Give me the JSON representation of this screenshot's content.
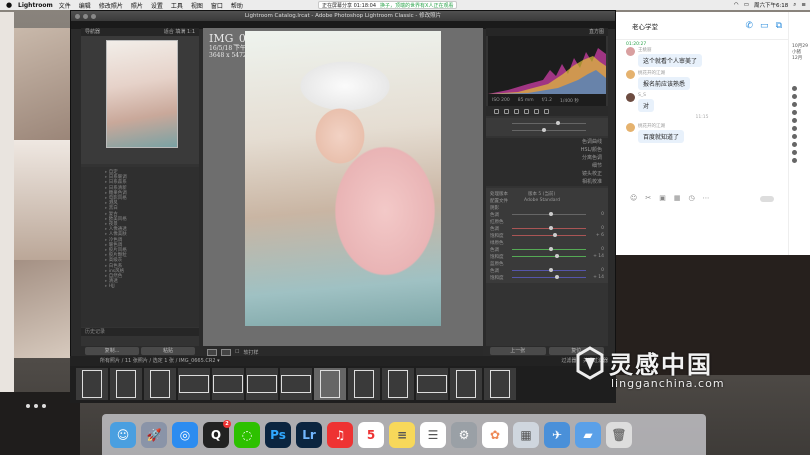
{
  "menubar": {
    "app": "Lightroom",
    "items": [
      "文件",
      "编辑",
      "修改照片",
      "照片",
      "设置",
      "工具",
      "视图",
      "窗口",
      "帮助"
    ],
    "share_status": "正在屏幕分享 01:18:04",
    "share_hint": "换子，顶端的世界有X人正在观看",
    "clock": "周六下午6:18"
  },
  "lightroom": {
    "window_title": "Lightroom Catalog.lrcat - Adobe Photoshop Lightroom Classic - 修改照片",
    "navigator_label": "导航器",
    "navigator_zoom": [
      "适合",
      "填满",
      "1:1"
    ],
    "presets": [
      "自定",
      "日系暖调",
      "日系森系",
      "日系清新",
      "糖果色调",
      "电影风格",
      "港风",
      "黑白",
      "复古",
      "欧美风格",
      "夜景",
      "人像通透",
      "人像美肤",
      "冷色调",
      "暖色调",
      "胶片风格",
      "胶片颗粒",
      "高级灰",
      "白色系",
      "ins风格",
      "自然色",
      "清透",
      "HJJ"
    ],
    "history_label": "历史记录",
    "copy_button": "复制...",
    "paste_button": "粘贴",
    "photo": {
      "filename": "IMG_0665.CR2",
      "line1": "16/5/18 下午2:27:41",
      "line2": "3648 x 5472"
    },
    "toolbar_label": "软打样",
    "histogram_label": "直方图",
    "histogram_info": [
      "ISO 200",
      "85 mm",
      "f/1.2",
      "1/400 秒"
    ],
    "sections": [
      "基本",
      "色调曲线",
      "HSL/颜色",
      "分离色调",
      "细节",
      "镜头校正",
      "相机校准"
    ],
    "calib": {
      "process_label": "处理版本",
      "process_value": "版本 5 (当前)",
      "profile_label": "配置文件",
      "profile_value": "Adobe Standard",
      "shadow_label": "阴影",
      "hue_label": "色调",
      "red_primary": "红原色",
      "green_primary": "绿原色",
      "blue_primary": "蓝原色",
      "sat_label": "饱和度",
      "values": [
        "0",
        "0",
        "0",
        "+ 6",
        "0",
        "+ 14",
        "0",
        "+ 14",
        "+ 14"
      ]
    },
    "prev_button": "上一张",
    "reset_button": "复位",
    "filmstrip_path": "所有照片 / 11 张照片 / 选定 1 张 / IMG_0665.CR2 ▾",
    "filter_label": "过滤器：",
    "filter_value": "关闭过滤器"
  },
  "chat": {
    "title": "老心学堂",
    "messages": [
      {
        "time": "01:20:27",
        "nick": "王桃丽",
        "text": "这个就看个人审美了"
      },
      {
        "time": "",
        "nick": "桃花开的江湖",
        "text": "报名前应该熟悉"
      },
      {
        "time": "",
        "nick": "S_S",
        "text": "对"
      },
      {
        "time": "",
        "nick": "桃花开的江湖",
        "text": "百度就知道了"
      }
    ],
    "system_note": "11:15",
    "side_labels": [
      "10月29",
      "小猪",
      "12月"
    ]
  },
  "watermark": {
    "cn": "灵感中国",
    "en": "lingganchina.com"
  },
  "dock": [
    "Finder",
    "Launchpad",
    "Safari",
    "QQ",
    "WeChat",
    "Ps",
    "Lr",
    "NetEase",
    "Calendar",
    "Notes",
    "Reminders",
    "Settings",
    "Photos",
    "Preview",
    "Airmail",
    "Folder",
    "Trash"
  ],
  "dock_badges": {
    "qq": "2",
    "calendar": "5"
  },
  "colors": {
    "lr_bg": "#2b2b2b",
    "chat_accent": "#2b8cdc",
    "chat_time": "#2aa34a"
  }
}
